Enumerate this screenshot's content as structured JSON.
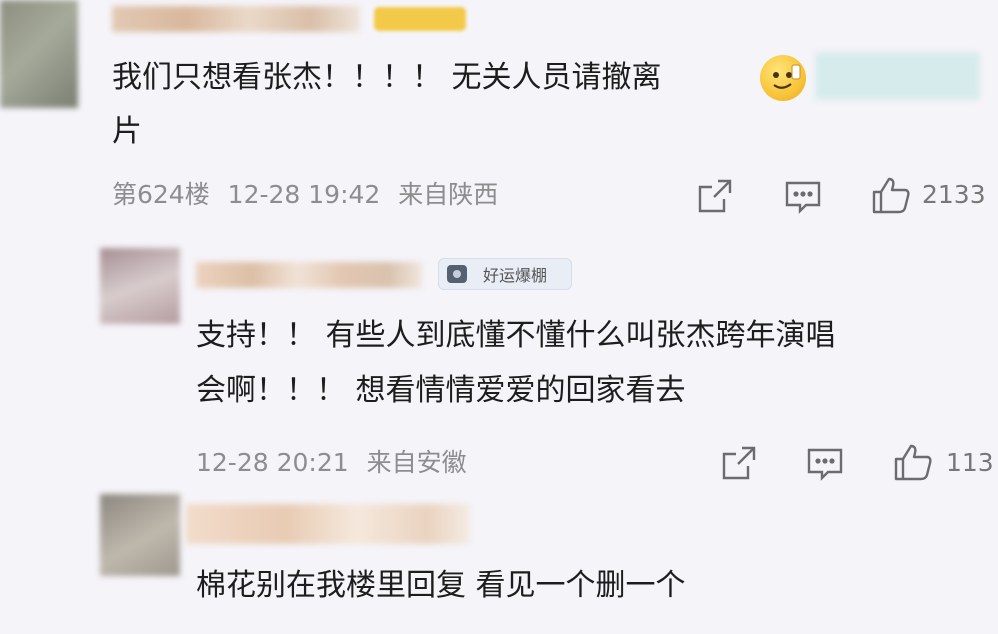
{
  "comments": [
    {
      "text_line1": "我们只想看张杰！！！！ 无关人员请撤离",
      "text_line2": "片",
      "floor": "第624楼",
      "time": "12-28 19:42",
      "location": "来自陕西",
      "likes": "2133"
    },
    {
      "badge": "好运爆棚",
      "text_line1": "支持！！ 有些人到底懂不懂什么叫张杰跨年演唱",
      "text_line2": "会啊！！！  想看情情爱爱的回家看去",
      "time": "12-28 20:21",
      "location": "来自安徽",
      "likes": "113"
    },
    {
      "text_line1": "棉花别在我楼里回复 看见一个删一个"
    }
  ],
  "icons": {
    "share": "share-icon",
    "comment": "comment-icon",
    "like": "thumbs-up-icon",
    "emoji": "emoji-icon"
  },
  "colors": {
    "background": "#f5f4f9",
    "text": "#1d1d1d",
    "meta": "#8d8d8f",
    "badge_gold": "#f3c94a"
  }
}
